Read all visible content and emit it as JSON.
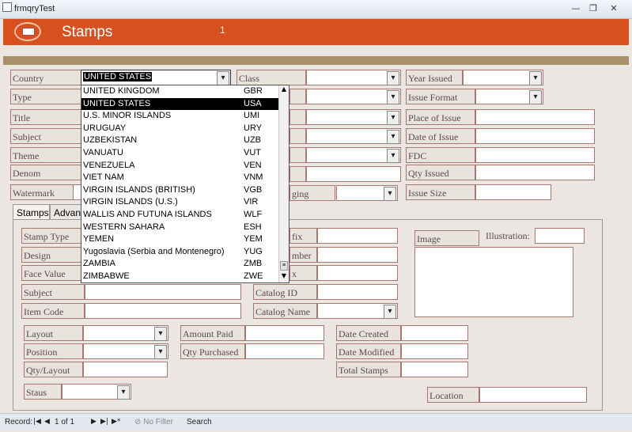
{
  "window": {
    "title": "frmqryTest"
  },
  "header": {
    "title": "Stamps",
    "number": "1"
  },
  "fields": {
    "country": "Country",
    "type": "Type",
    "title": "Title",
    "subject": "Subject",
    "theme": "Theme",
    "denom": "Denom",
    "watermark": "Watermark",
    "class": "Class",
    "hinging": "ging",
    "year_issued": "Year Issued",
    "issue_format": "Issue Format",
    "place_of_issue": "Place of Issue",
    "date_of_issue": "Date of Issue",
    "fdc": "FDC",
    "qty_issued": "Qty Issued",
    "issue_size": "Issue Size"
  },
  "country_value": "UNITED STATES",
  "tabs": [
    "Stamps",
    "Advanc"
  ],
  "panel": {
    "stamp_type": "Stamp Type",
    "design": "Design",
    "face_value": "Face Value",
    "subject": "Subject",
    "item_code": "Item Code",
    "prefix": "fix",
    "number": "mber",
    "suffix": "x",
    "catalog_id": "Catalog ID",
    "catalog_name": "Catalog Name",
    "image": "Image",
    "illustration": "Illustration:",
    "layout": "Layout",
    "position": "Position",
    "qty_layout": "Qty/Layout",
    "staus": "Staus",
    "amount_paid": "Amount Paid",
    "qty_purchased": "Qty Purchased",
    "date_created": "Date Created",
    "date_modified": "Date Modified",
    "total_stamps": "Total Stamps",
    "location": "Location"
  },
  "dropdown": [
    {
      "name": "UNITED KINGDOM",
      "code": "GBR"
    },
    {
      "name": "UNITED STATES",
      "code": "USA",
      "selected": true
    },
    {
      "name": "U.S. MINOR ISLANDS",
      "code": "UMI"
    },
    {
      "name": "URUGUAY",
      "code": "URY"
    },
    {
      "name": "UZBEKISTAN",
      "code": "UZB"
    },
    {
      "name": "VANUATU",
      "code": "VUT"
    },
    {
      "name": "VENEZUELA",
      "code": "VEN"
    },
    {
      "name": "VIET NAM",
      "code": "VNM"
    },
    {
      "name": "VIRGIN ISLANDS (BRITISH)",
      "code": "VGB"
    },
    {
      "name": "VIRGIN ISLANDS (U.S.)",
      "code": "VIR"
    },
    {
      "name": "WALLIS AND FUTUNA ISLANDS",
      "code": "WLF"
    },
    {
      "name": "WESTERN SAHARA",
      "code": "ESH"
    },
    {
      "name": "YEMEN",
      "code": "YEM"
    },
    {
      "name": "Yugoslavia (Serbia and Montenegro)",
      "code": "YUG"
    },
    {
      "name": "ZAMBIA",
      "code": "ZMB"
    },
    {
      "name": "ZIMBABWE",
      "code": "ZWE"
    }
  ],
  "status": {
    "record_label": "Record:",
    "record_value": "1 of 1",
    "no_filter": "No Filter",
    "search": "Search"
  }
}
